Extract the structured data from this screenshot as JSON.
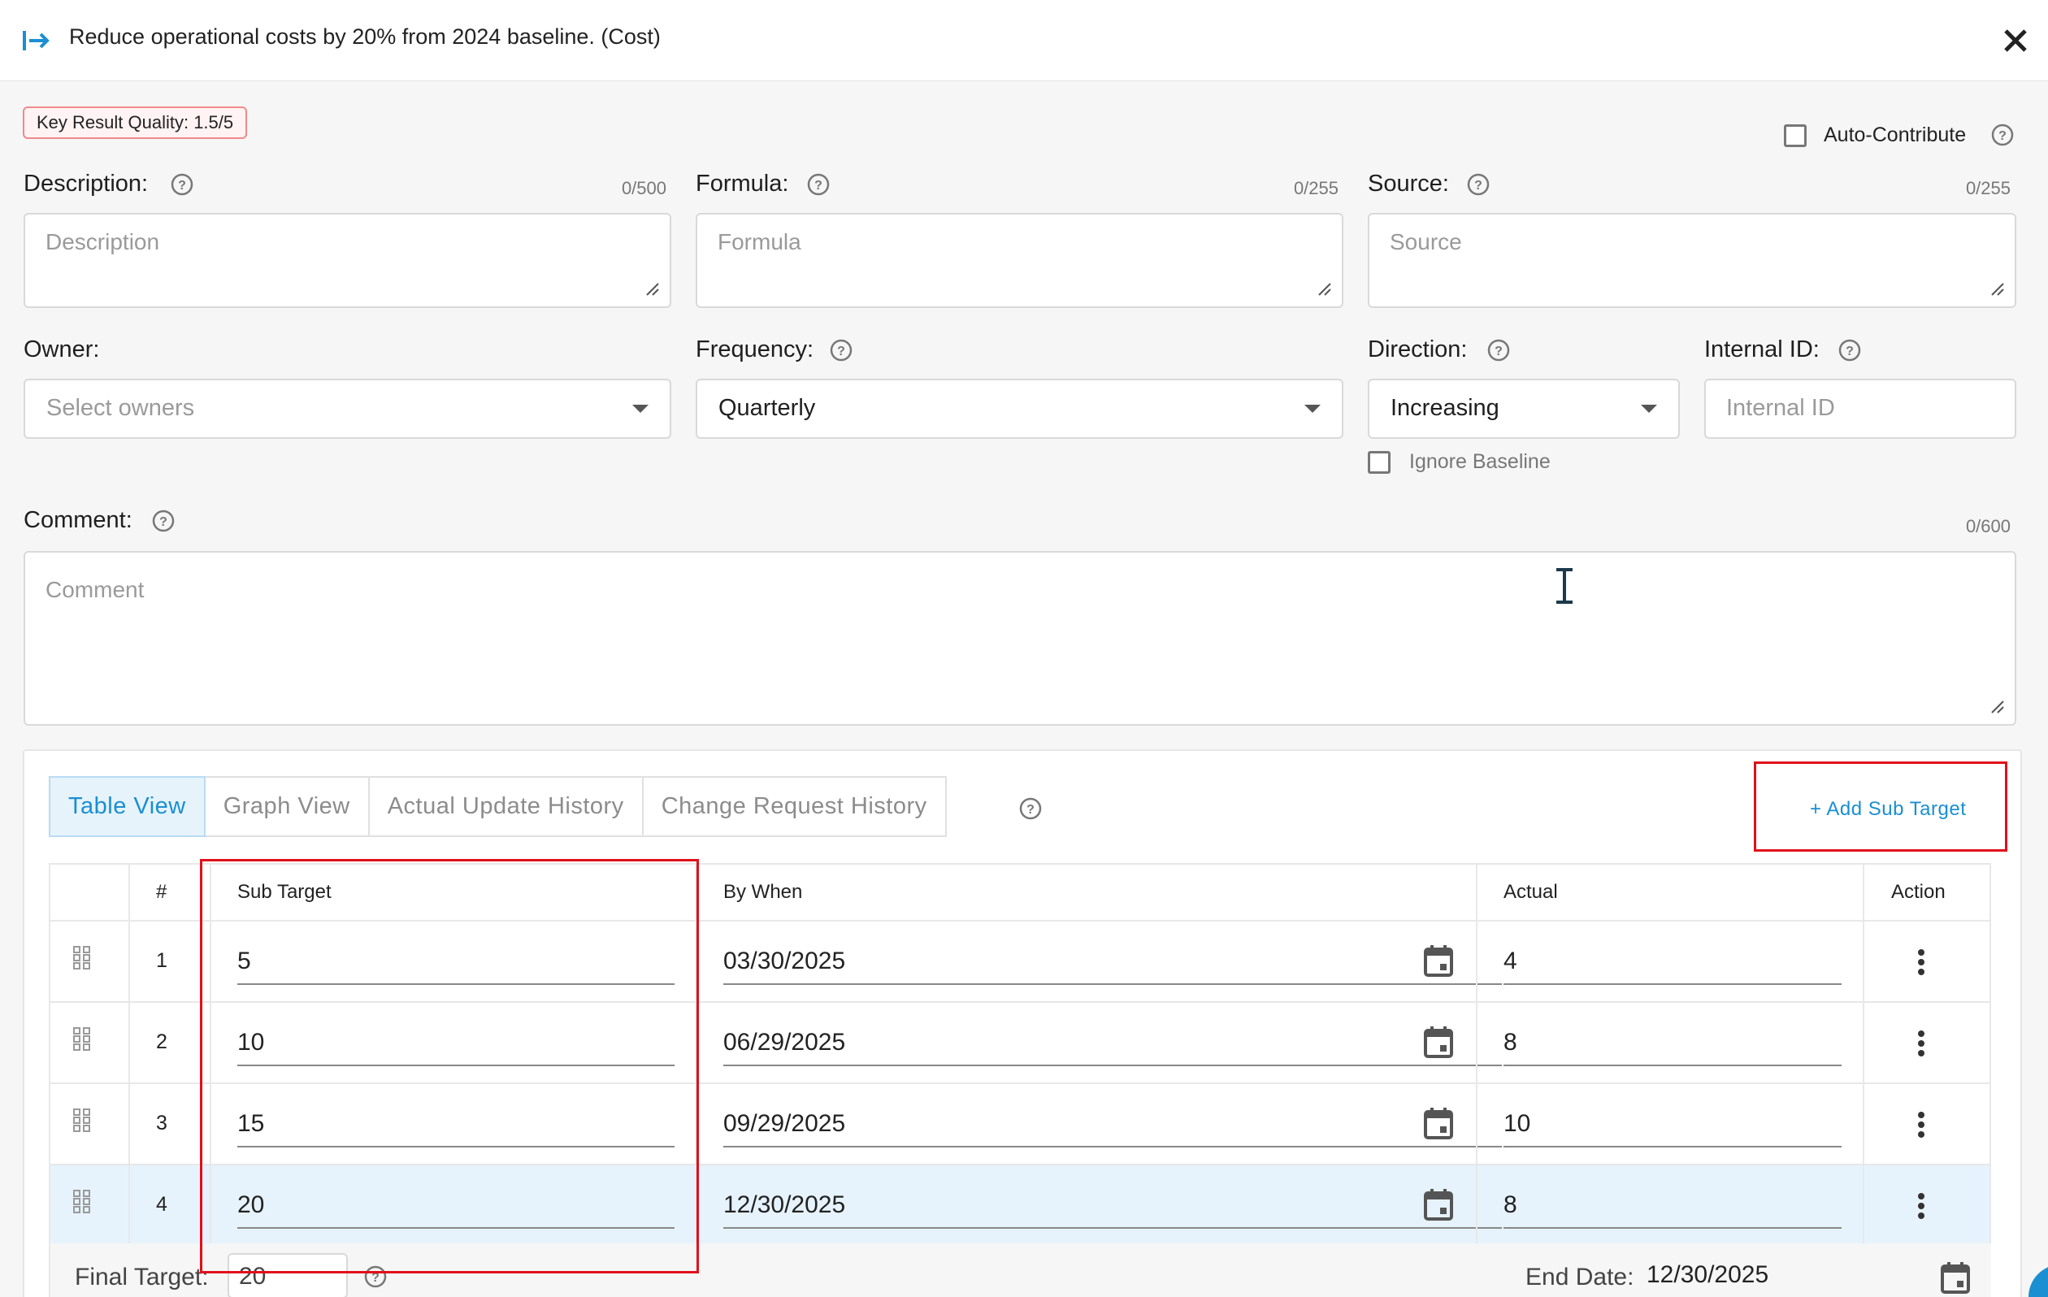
{
  "header": {
    "title": "Reduce operational costs by 20% from 2024 baseline. (Cost)"
  },
  "quality_badge": "Key Result Quality: 1.5/5",
  "auto_contribute": {
    "label": "Auto-Contribute",
    "checked": false
  },
  "description": {
    "label": "Description:",
    "counter": "0/500",
    "placeholder": "Description"
  },
  "formula": {
    "label": "Formula:",
    "counter": "0/255",
    "placeholder": "Formula"
  },
  "source": {
    "label": "Source:",
    "counter": "0/255",
    "placeholder": "Source"
  },
  "owner": {
    "label": "Owner:",
    "placeholder": "Select owners"
  },
  "frequency": {
    "label": "Frequency:",
    "value": "Quarterly"
  },
  "direction": {
    "label": "Direction:",
    "value": "Increasing"
  },
  "internal_id": {
    "label": "Internal ID:",
    "placeholder": "Internal ID"
  },
  "ignore_baseline": {
    "label": "Ignore Baseline",
    "checked": false
  },
  "comment": {
    "label": "Comment:",
    "counter": "0/600",
    "placeholder": "Comment"
  },
  "tabs": [
    {
      "label": "Table View",
      "active": true
    },
    {
      "label": "Graph View",
      "active": false
    },
    {
      "label": "Actual Update History",
      "active": false
    },
    {
      "label": "Change Request History",
      "active": false
    }
  ],
  "add_sub_target_label": "+ Add Sub Target",
  "table": {
    "headers": {
      "num": "#",
      "sub_target": "Sub Target",
      "by_when": "By When",
      "actual": "Actual",
      "action": "Action"
    },
    "rows": [
      {
        "num": "1",
        "sub_target": "5",
        "by_when": "03/30/2025",
        "actual": "4",
        "highlighted": false
      },
      {
        "num": "2",
        "sub_target": "10",
        "by_when": "06/29/2025",
        "actual": "8",
        "highlighted": false
      },
      {
        "num": "3",
        "sub_target": "15",
        "by_when": "09/29/2025",
        "actual": "10",
        "highlighted": false
      },
      {
        "num": "4",
        "sub_target": "20",
        "by_when": "12/30/2025",
        "actual": "8",
        "highlighted": true
      }
    ]
  },
  "footer": {
    "final_target_label": "Final Target:",
    "final_target_value": "20",
    "end_date_label": "End Date:",
    "end_date_value": "12/30/2025"
  },
  "colors": {
    "accent": "#1a8fd1",
    "highlight_box": "#e0101a",
    "row_highlight": "#e6f3fc"
  }
}
